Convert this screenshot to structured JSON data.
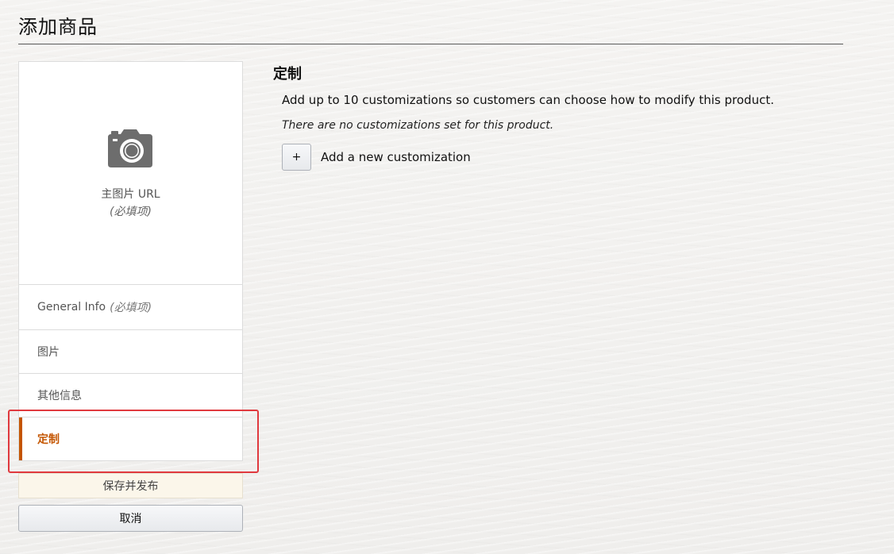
{
  "page": {
    "title": "添加商品"
  },
  "image_box": {
    "label": "主图片 URL",
    "required": "(必填项)"
  },
  "nav": {
    "items": [
      {
        "label": "General Info",
        "required": "(必填项)"
      },
      {
        "label": "图片"
      },
      {
        "label": "其他信息"
      },
      {
        "label": "定制",
        "active": true
      }
    ]
  },
  "actions": {
    "save_label": "保存并发布",
    "cancel_label": "取消"
  },
  "section": {
    "title": "定制",
    "description": "Add up to 10 customizations so customers can choose how to modify this product.",
    "empty_text": "There are no customizations set for this product.",
    "add_button_symbol": "+",
    "add_label": "Add a new customization"
  },
  "colors": {
    "accent": "#c45500",
    "highlight": "#e0393e"
  },
  "icons": {
    "image_placeholder": "camera-icon"
  }
}
